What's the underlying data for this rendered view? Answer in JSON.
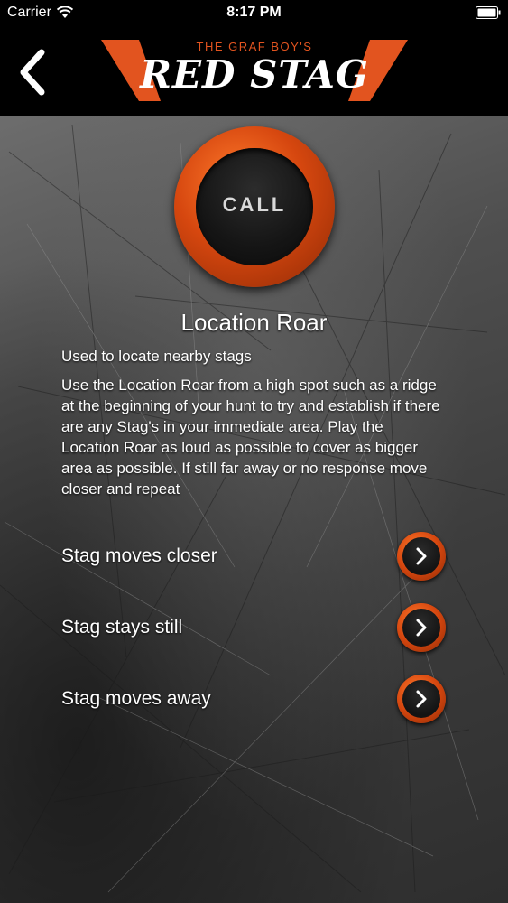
{
  "status_bar": {
    "carrier": "Carrier",
    "time": "8:17 PM"
  },
  "header": {
    "logo_subtitle": "THE GRAF BOY'S",
    "logo_title": "RED STAG"
  },
  "call": {
    "button_label": "CALL",
    "title": "Location Roar",
    "subtitle": "Used to locate nearby stags",
    "description": "Use the Location Roar from a high spot such as a ridge at the beginning of your hunt to try and establish if there are any Stag's in your immediate area. Play the Location Roar as loud as possible to cover as bigger area as possible. If still far away or no response move closer and repeat"
  },
  "responses": [
    {
      "label": "Stag moves closer"
    },
    {
      "label": "Stag stays still"
    },
    {
      "label": "Stag moves away"
    }
  ],
  "colors": {
    "accent": "#e2541f",
    "header_bg": "#000000",
    "text": "#ffffff"
  },
  "icons": {
    "back": "chevron-left-icon",
    "next": "chevron-right-icon",
    "wifi": "wifi-icon",
    "battery": "battery-icon"
  }
}
